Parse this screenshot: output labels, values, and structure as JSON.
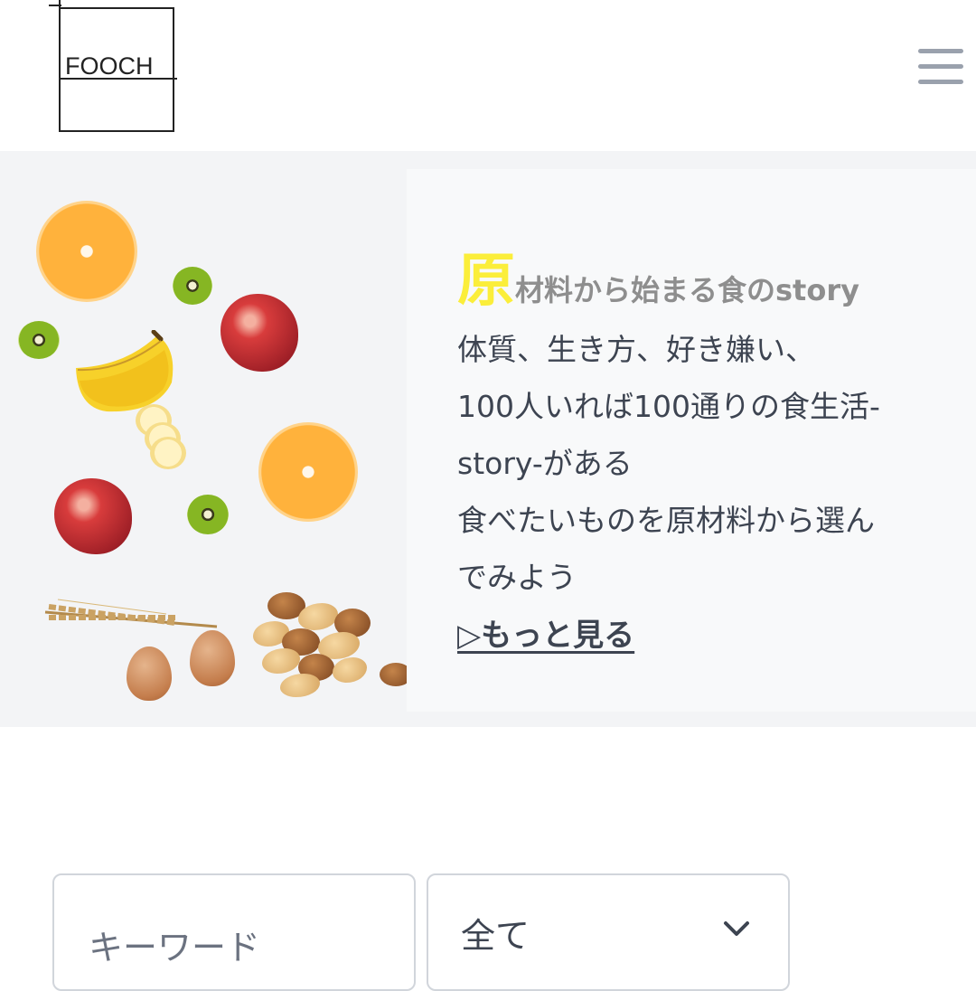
{
  "header": {
    "logo_text": "FOOCH",
    "menu_icon": "hamburger-menu-icon"
  },
  "hero": {
    "tagline_initial": "原",
    "tagline_rest": "材料から始まる食のstory",
    "description_lines": [
      "体質、生き方、好き嫌い、",
      "100人いれば100通りの食生活-",
      "story-がある",
      "食べたいものを原材料から選ん",
      "でみよう"
    ],
    "more_link": "▷もっと見る",
    "images": [
      "orange",
      "kiwi",
      "apple",
      "banana",
      "egg",
      "wheat",
      "mixed-nuts"
    ],
    "colors": {
      "accent_yellow": "#fbee3a",
      "text": "#3d4451",
      "muted": "#8e8e8e"
    }
  },
  "search": {
    "keyword_placeholder": "キーワード",
    "category_selected": "全て",
    "category_icon": "chevron-down-icon"
  }
}
